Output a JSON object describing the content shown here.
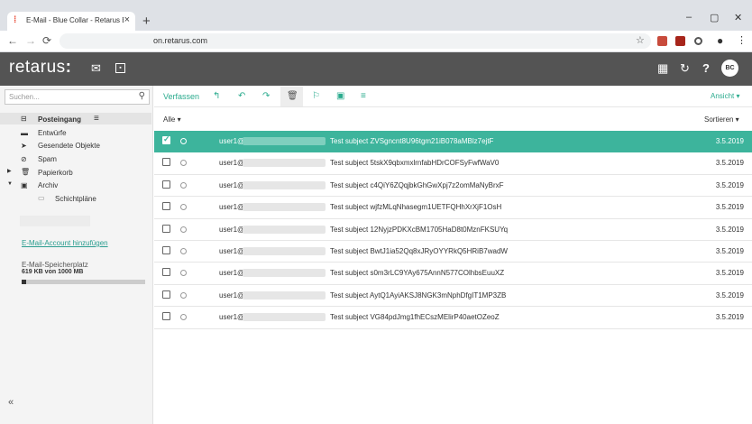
{
  "browser": {
    "tab_title": "E-Mail - Blue Collar - Retarus Em",
    "tab_close": "×",
    "new_tab": "+",
    "url": "on.retarus.com",
    "win_min": "–",
    "win_max": "▢",
    "win_close": "✕"
  },
  "app": {
    "logo": "retarus",
    "logo_dots": ":",
    "avatar": "BC"
  },
  "sidebar": {
    "search_placeholder": "Suchen...",
    "folders": [
      {
        "label": "Posteingang",
        "icon": "inbox-icon"
      },
      {
        "label": "Entwürfe",
        "icon": "draft-icon"
      },
      {
        "label": "Gesendete Objekte",
        "icon": "send-icon"
      },
      {
        "label": "Spam",
        "icon": "spam-icon"
      },
      {
        "label": "Papierkorb",
        "icon": "trash-icon"
      },
      {
        "label": "Archiv",
        "icon": "archive-icon"
      },
      {
        "label": "Schichtpläne",
        "icon": "folder-icon"
      }
    ],
    "add_account": "E-Mail-Account hinzufügen",
    "storage_label": "E-Mail-Speicherplatz",
    "storage_value": "619 KB von 1000 MB",
    "storage_fraction": 0.04,
    "collapse": "«"
  },
  "toolbar": {
    "compose": "Verfassen",
    "view": "Ansicht ▾"
  },
  "list": {
    "filter": "Alle ▾",
    "sort": "Sortieren ▾",
    "rows": [
      {
        "from": "user1@",
        "subject": "Test subject ZVSgncnt8U96tgm21iB078aMBlz7ejtF",
        "date": "3.5.2019",
        "selected": true
      },
      {
        "from": "user1@",
        "subject": "Test subject 5tskX9qbxmxlrnfabHDrCOFSyFwfWaV0",
        "date": "3.5.2019",
        "selected": false
      },
      {
        "from": "user1@",
        "subject": "Test subject c4QiY6ZQqjbkGhGwXpj7z2omMaNyBrxF",
        "date": "3.5.2019",
        "selected": false
      },
      {
        "from": "user1@",
        "subject": "Test subject wjfzMLqNhasegm1UETFQHhXrXjF1OsH",
        "date": "3.5.2019",
        "selected": false
      },
      {
        "from": "user1@",
        "subject": "Test subject 12NyjzPDKXcBM1705HaD8t0MznFKSUYq",
        "date": "3.5.2019",
        "selected": false
      },
      {
        "from": "user1@",
        "subject": "Test subject BwtJ1ia52Qq8xJRyOYYRkQ5HRiB7wadW",
        "date": "3.5.2019",
        "selected": false
      },
      {
        "from": "user1@",
        "subject": "Test subject s0m3rLC9YAy675AnnN577COlhbsEuuXZ",
        "date": "3.5.2019",
        "selected": false
      },
      {
        "from": "user1@",
        "subject": "Test subject AytQ1AyiAKSJ8NGK3mNphDfgIT1MP3ZB",
        "date": "3.5.2019",
        "selected": false
      },
      {
        "from": "user1@",
        "subject": "Test subject VG84pdJmg1fhECszMElirP40aetOZeoZ",
        "date": "3.5.2019",
        "selected": false
      }
    ]
  }
}
